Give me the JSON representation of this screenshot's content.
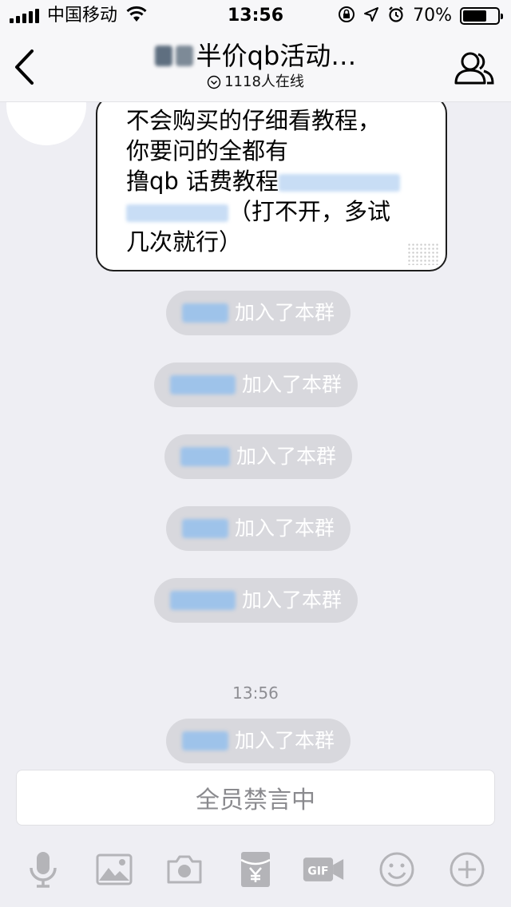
{
  "status_bar": {
    "carrier": "中国移动",
    "time": "13:56",
    "battery_percent": "70%",
    "battery_level": 0.7,
    "icons": [
      "signal-icon",
      "wifi-icon",
      "orientation-lock-icon",
      "location-icon",
      "alarm-icon",
      "battery-icon"
    ]
  },
  "nav": {
    "title": "半价qb活动…",
    "online": "1118人在线",
    "icons": [
      "back-icon",
      "online-chevron-icon",
      "group-members-icon"
    ]
  },
  "message": {
    "line1": "不会购买的仔细看教程，",
    "line2": "你要问的全都有",
    "line3": "撸qb  话费教程",
    "line4": "（打不开，多试",
    "line5": "几次就行）"
  },
  "system_messages": [
    {
      "text": "加入了本群"
    },
    {
      "text": "加入了本群"
    },
    {
      "text": "加入了本群"
    },
    {
      "text": "加入了本群"
    },
    {
      "text": "加入了本群"
    },
    {
      "text": "加入了本群"
    }
  ],
  "timestamp": "13:56",
  "mute_bar": {
    "label": "全员禁言中"
  },
  "toolbar": {
    "icons": [
      "microphone-icon",
      "image-icon",
      "camera-icon",
      "red-packet-icon",
      "gif-icon",
      "emoji-icon",
      "plus-icon"
    ]
  },
  "colors": {
    "background": "#eeeef3",
    "bar": "#f7f7f9",
    "pill": "#d8d8dd",
    "icon_gray": "#b4b4b8",
    "blur_blue": "#9ec3ea"
  }
}
